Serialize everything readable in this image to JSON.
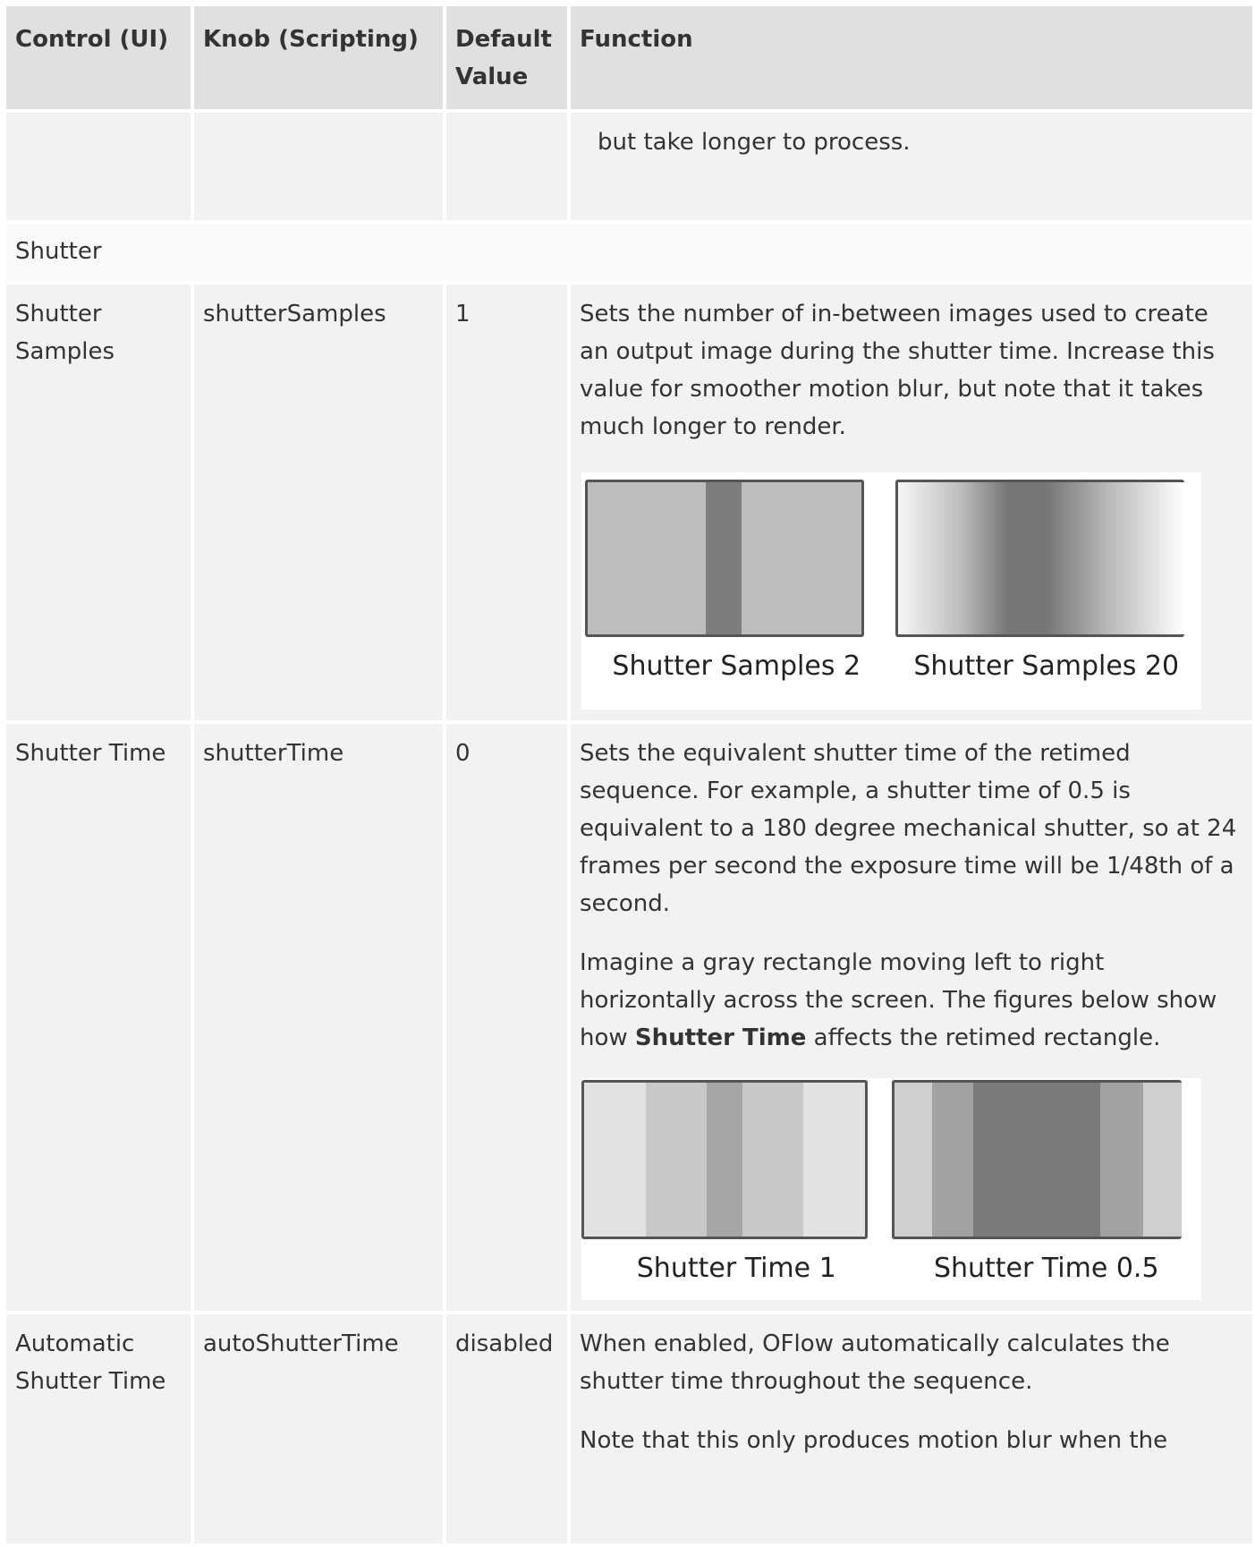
{
  "table": {
    "headers": [
      "Control (UI)",
      "Knob (Scripting)",
      "Default Value",
      "Function"
    ],
    "row0": {
      "function": "but take longer to process."
    },
    "section": "Shutter",
    "rows": [
      {
        "control": "Shutter Samples",
        "knob": "shutterSamples",
        "default": "1",
        "function": [
          "Sets the number of in-between images used to create an output image during the shutter time. Increase this value for smoother motion blur, but note that it takes much longer to render."
        ],
        "figures": [
          {
            "caption": "Shutter Samples 2",
            "icon": "sharp-rectangle-figure"
          },
          {
            "caption": "Shutter Samples 20",
            "icon": "gradient-blur-figure"
          }
        ]
      },
      {
        "control": "Shutter Time",
        "knob": "shutterTime",
        "default": "0",
        "function": [
          "Sets the equivalent shutter time of the retimed sequence. For example, a shutter time of 0.5 is equivalent to a 180 degree mechanical shutter, so at 24 frames per second the exposure time will be 1/48th of a second.",
          "Imagine a gray rectangle moving left to right horizontally across the screen. The figures below show how",
          "Shutter Time",
          "affects the retimed rectangle."
        ],
        "figures": [
          {
            "caption": "Shutter Time 1",
            "icon": "stepped-blur-figure"
          },
          {
            "caption": "Shutter Time 0.5",
            "icon": "narrow-stepped-blur-figure"
          }
        ]
      },
      {
        "control": "Automatic Shutter Time",
        "knob": "autoShutterTime",
        "default": "disabled",
        "function": [
          "When enabled, OFlow automatically calculates the shutter time throughout the sequence.",
          "Note that this only produces motion blur when the"
        ]
      }
    ]
  }
}
